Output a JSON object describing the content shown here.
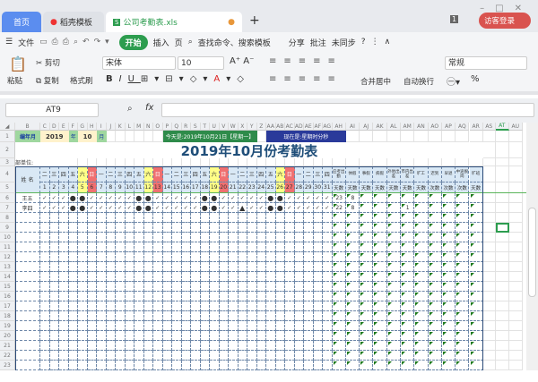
{
  "tabs": {
    "home": "首页",
    "template": "稻壳模板",
    "file": "公司考勤表.xls",
    "add": "+",
    "badge": "1",
    "login": "访客登录"
  },
  "toolbar": {
    "menu": "文件",
    "start": "开始",
    "insert": "插入",
    "page": "页",
    "search": "查找命令、搜索模板",
    "share": "分享",
    "comment": "批注",
    "sync": "未同步",
    "help": "?"
  },
  "ribbon": {
    "paste": "粘贴",
    "cut": "剪切",
    "copy": "复制",
    "format_painter": "格式刷",
    "font": "宋体",
    "size": "10",
    "merge": "合并居中",
    "wrap": "自动换行",
    "number_format": "常规",
    "percent": "%"
  },
  "formula": {
    "cell_ref": "AT9",
    "fx": "fx",
    "value": ""
  },
  "columns": [
    "B",
    "C",
    "D",
    "E",
    "F",
    "G",
    "H",
    "I",
    "J",
    "K",
    "L",
    "M",
    "N",
    "O",
    "P",
    "Q",
    "R",
    "S",
    "T",
    "U",
    "V",
    "W",
    "X",
    "Y",
    "Z",
    "AA",
    "AB",
    "AC",
    "AD",
    "AE",
    "AF",
    "AG",
    "AH",
    "AI",
    "AJ",
    "AK",
    "AL",
    "AM",
    "AN",
    "AO",
    "AP",
    "AQ",
    "AR",
    "AS",
    "AT",
    "AU"
  ],
  "sheet": {
    "r1": {
      "label": "编年月",
      "year": "2019",
      "year_unit": "年",
      "month": "10",
      "month_unit": "月",
      "today": "今天是:2019年10月21日【星期一】",
      "now": "现在是:星期时分秒"
    },
    "title": "2019年10月份考勤表",
    "unit_label": "部单位:",
    "name_header": "姓 名",
    "weekdays": [
      "二",
      "三",
      "四",
      "五",
      "六",
      "日",
      "一",
      "二",
      "三",
      "四",
      "五",
      "六",
      "日",
      "一",
      "二",
      "三",
      "四",
      "五",
      "六",
      "日",
      "一",
      "二",
      "三",
      "四",
      "五",
      "六",
      "日",
      "一",
      "二",
      "三",
      "四"
    ],
    "days": [
      "1",
      "2",
      "3",
      "4",
      "5",
      "6",
      "7",
      "8",
      "9",
      "10",
      "11",
      "12",
      "13",
      "14",
      "15",
      "16",
      "17",
      "18",
      "19",
      "20",
      "21",
      "22",
      "23",
      "24",
      "25",
      "26",
      "27",
      "28",
      "29",
      "30",
      "31"
    ],
    "summary_headers": [
      "应考出勤",
      "休假",
      "事假",
      "病假",
      "外地出差",
      "市内出差",
      "旷工",
      "迟到",
      "早退",
      "中途脱岗",
      "旷班"
    ],
    "summary_units": [
      "天数",
      "天数",
      "天数",
      "天数",
      "天数",
      "天数",
      "天数",
      "次数",
      "次数",
      "次数",
      "天数"
    ],
    "employees": [
      {
        "name": "王五",
        "marks": [
          "✓",
          "✓",
          "✓",
          "●",
          "●",
          "✓",
          "✓",
          "✓",
          "✓",
          "✓",
          "●",
          "●",
          "✓",
          "✓",
          "✓",
          "✓",
          "✓",
          "●",
          "●",
          "✓",
          "✓",
          "✓",
          "✓",
          "✓",
          "●",
          "●",
          "✓",
          "✓",
          "✓",
          "✓",
          "✓"
        ],
        "summary": [
          "23",
          "8",
          "",
          "",
          "",
          "",
          "",
          "",
          "",
          "",
          ""
        ]
      },
      {
        "name": "李四",
        "marks": [
          "✓",
          "✓",
          "✓",
          "●",
          "●",
          "✓",
          "✓",
          "✓",
          "✓",
          "✓",
          "●",
          "●",
          "✓",
          "✓",
          "✓",
          "✓",
          "✓",
          "●",
          "●",
          "✓",
          "✓",
          "▲",
          "✓",
          "✓",
          "●",
          "●",
          "✓",
          "✓",
          "✓",
          "✓",
          "✓"
        ],
        "summary": [
          "22",
          "8",
          "",
          "",
          "",
          "1",
          "",
          "",
          "",
          "",
          ""
        ]
      }
    ],
    "selected": "AT9"
  },
  "colors": {
    "accent": "#2d9d4f",
    "home_tab": "#5b8def",
    "header_fill": "#d9e8f5",
    "saturday": "#ffff88",
    "sunday": "#f07070",
    "title": "#1f4e79",
    "today_fill": "#2e8b4a",
    "now_fill": "#2a3a9a",
    "label_fill": "#9fd79f",
    "year_fill": "#fff2cc"
  }
}
